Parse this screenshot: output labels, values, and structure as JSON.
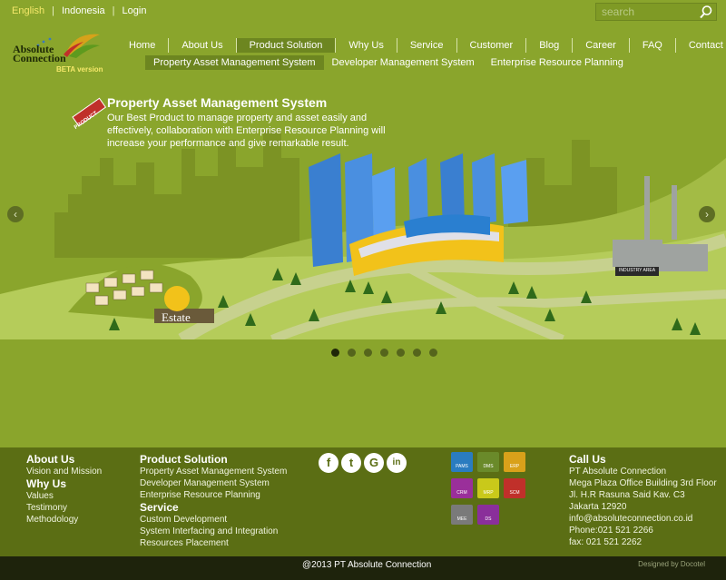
{
  "header": {
    "languages": [
      {
        "label": "English",
        "active": true
      },
      {
        "label": "Indonesia",
        "active": false
      },
      {
        "label": "Login",
        "active": false
      }
    ],
    "separator": "|",
    "search": {
      "placeholder": "search"
    },
    "logo": {
      "line1": "Absolute",
      "line2": "Connection",
      "badge": "BETA version"
    }
  },
  "nav": {
    "main": [
      "Home",
      "About Us",
      "Product Solution",
      "Why Us",
      "Service",
      "Customer",
      "Blog",
      "Career",
      "FAQ",
      "Contact Us"
    ],
    "active_index": 2,
    "sub": [
      "Property Asset Management System",
      "Developer Management System",
      "Enterprise Resource Planning"
    ],
    "sub_active_index": 0
  },
  "banner": {
    "title": "Property Asset Management System",
    "description": "Our Best Product to manage property and asset easily and effectively, collaboration with Enterprise Resource Planning will increase your performance and give remarkable result.",
    "tag": "PRODUCT",
    "estate_label": "Estate",
    "industry_label": "INDUSTRY AREA",
    "prev": "‹",
    "next": "›",
    "slide_count": 7,
    "active_slide": 0
  },
  "footer": {
    "about": {
      "title": "About Us",
      "links": [
        "Vision and Mission"
      ]
    },
    "why": {
      "title": "Why Us",
      "links": [
        "Values",
        "Testimony",
        "Methodology"
      ]
    },
    "product": {
      "title": "Product Solution",
      "links": [
        "Property Asset Management System",
        "Developer Management System",
        "Enterprise Resource Planning"
      ]
    },
    "service": {
      "title": "Service",
      "links": [
        "Custom Development",
        "System Interfacing and Integration",
        "Resources Placement"
      ]
    },
    "social": [
      "f",
      "t",
      "G",
      "in"
    ],
    "products": [
      {
        "label": "PAMS",
        "color": "#2a7cc0"
      },
      {
        "label": "DMS",
        "color": "#6a8a2a"
      },
      {
        "label": "ERP",
        "color": "#d9a11a"
      },
      {
        "label": "CRM",
        "color": "#9a2f9a"
      },
      {
        "label": "MRP",
        "color": "#c9c91a"
      },
      {
        "label": "SCM",
        "color": "#c0302a"
      },
      {
        "label": "MEE",
        "color": "#7a7a7a"
      },
      {
        "label": "DS",
        "color": "#8a2f9a"
      }
    ],
    "call": {
      "title": "Call Us",
      "lines": [
        "PT Absolute Connection",
        "Mega Plaza Office Building 3rd Floor",
        "Jl. H.R Rasuna Said Kav. C3",
        "Jakarta 12920",
        "info@absoluteconnection.co.id",
        "Phone:021 521 2266",
        "fax: 021 521 2262"
      ]
    }
  },
  "copyright": "@2013 PT Absolute Connection",
  "designer": "Designed by Docotel"
}
